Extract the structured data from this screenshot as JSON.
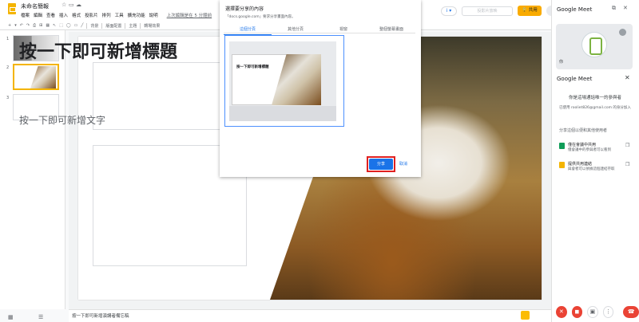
{
  "app": {
    "title": "未命名簡報",
    "menus": [
      "檔案",
      "編輯",
      "查看",
      "插入",
      "格式",
      "投影片",
      "排列",
      "工具",
      "擴充功能",
      "說明"
    ],
    "last_edit": "上次編輯是在 5 分鐘前"
  },
  "toolbar": {
    "items": [
      "+",
      "▾",
      "↶",
      "↷",
      "⎙",
      "⊞",
      "▦",
      "↖",
      "⬚",
      "◯",
      "▭",
      "╱"
    ],
    "background": "背景",
    "layout": "版面配置",
    "theme": "主題",
    "transition": "轉場效果"
  },
  "header": {
    "slideshow_label": "投影片放映",
    "share_label": "共用",
    "meet_chip": "ı̇ ▾"
  },
  "filmstrip": {
    "numbers": [
      "1",
      "2",
      "3"
    ]
  },
  "slide": {
    "title_placeholder": "按一下即可新增標題",
    "body_placeholder": "按一下即可新增文字"
  },
  "notes": {
    "placeholder": "按一下即可新增演講者備忘稿"
  },
  "dialog": {
    "title": "選擇要分享的內容",
    "subtitle": "「docs.google.com」要求分享畫面內容。",
    "tabs": [
      {
        "label": "這個分頁",
        "active": true
      },
      {
        "label": "其他分頁",
        "active": false
      },
      {
        "label": "視窗",
        "active": false
      },
      {
        "label": "整個螢幕畫面",
        "active": false
      }
    ],
    "preview_title": "按一下即可新增標題",
    "share_label": "分享",
    "cancel_label": "取消"
  },
  "sidebar": {
    "title": "Google Meet",
    "you_label": "你",
    "panel_title": "Google Meet",
    "alone_message": "你是這場通話唯一的參與者",
    "joined_as": "已使用 rooliet826@gmail.com 的身分加入",
    "share_header": "分享這個以便和其他使用者",
    "share_items": [
      {
        "title": "僅在會議中共用",
        "subtitle": "僅會議中的參與者可以看到",
        "icon": "slides-share-icon"
      },
      {
        "title": "提供共用連結",
        "subtitle": "與會者可以依據這個連結存取",
        "icon": "present-tab-icon"
      }
    ],
    "controls": [
      "mic-off-icon",
      "camera-off-icon",
      "present-icon",
      "more-icon",
      "end-call-icon"
    ]
  },
  "colors": {
    "accent": "#1a73e8",
    "share": "#f9ab00",
    "danger": "#ea4335",
    "highlight": "#e02020"
  }
}
